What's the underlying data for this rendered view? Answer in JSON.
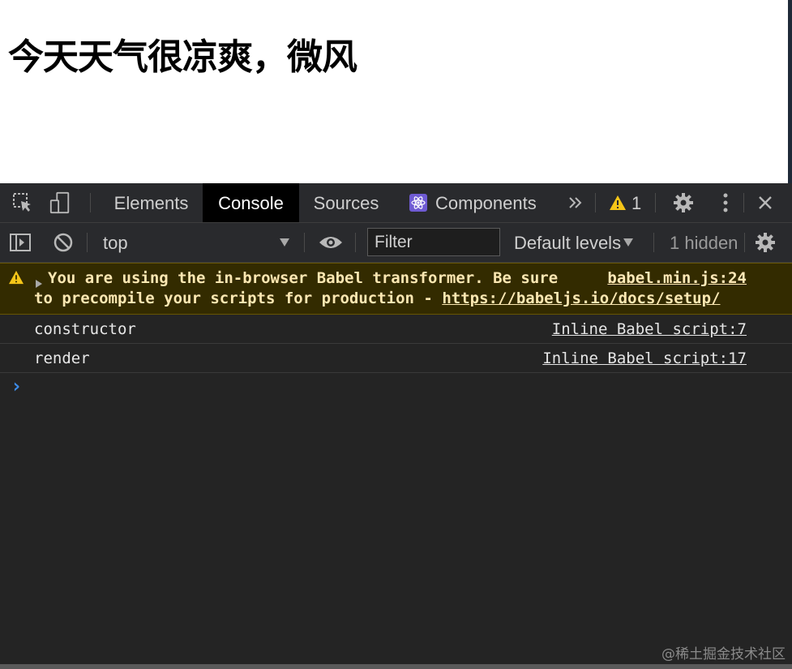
{
  "page": {
    "heading": "今天天气很凉爽，微风"
  },
  "devtools": {
    "tabs": [
      {
        "label": "Elements",
        "active": false
      },
      {
        "label": "Console",
        "active": true
      },
      {
        "label": "Sources",
        "active": false
      },
      {
        "label": "Components",
        "active": false
      }
    ],
    "warning_count": "1",
    "toolbar": {
      "context": "top",
      "filter_placeholder": "Filter",
      "levels": "Default levels",
      "hidden": "1 hidden"
    },
    "messages": [
      {
        "type": "warning",
        "line1": "You are using the in-browser Babel transformer. Be sure",
        "line2_prefix": "to precompile your scripts for production - ",
        "link": "https://babeljs.io/docs/setup/",
        "source": "babel.min.js:24"
      },
      {
        "type": "log",
        "text": "constructor",
        "source": "Inline Babel script:7"
      },
      {
        "type": "log",
        "text": "render",
        "source": "Inline Babel script:17"
      }
    ],
    "prompt": "›"
  },
  "watermark": "@稀土掘金技术社区",
  "colors": {
    "panel_bg": "#242424",
    "toolbar_bg": "#292a2d",
    "warning_bg": "#332b00",
    "warning_icon": "#f5c518",
    "prompt": "#3d8be8",
    "components_icon": "#6f5bd3"
  }
}
